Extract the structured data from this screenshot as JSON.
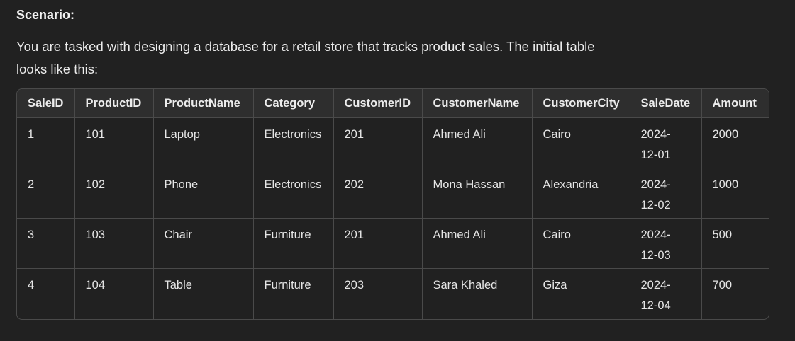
{
  "heading": "Scenario:",
  "intro_line1": "You are tasked with designing a database for a retail store that tracks product sales. The initial table",
  "intro_line2": "looks like this:",
  "table": {
    "columns": [
      "SaleID",
      "ProductID",
      "ProductName",
      "Category",
      "CustomerID",
      "CustomerName",
      "CustomerCity",
      "SaleDate",
      "Amount"
    ],
    "rows": [
      {
        "sale_id": "1",
        "product_id": "101",
        "product_name": "Laptop",
        "category": "Electronics",
        "customer_id": "201",
        "customer_name": "Ahmed Ali",
        "customer_city": "Cairo",
        "sale_date_1": "2024-",
        "sale_date_2": "12-01",
        "amount": "2000"
      },
      {
        "sale_id": "2",
        "product_id": "102",
        "product_name": "Phone",
        "category": "Electronics",
        "customer_id": "202",
        "customer_name": "Mona Hassan",
        "customer_city": "Alexandria",
        "sale_date_1": "2024-",
        "sale_date_2": "12-02",
        "amount": "1000"
      },
      {
        "sale_id": "3",
        "product_id": "103",
        "product_name": "Chair",
        "category": "Furniture",
        "customer_id": "201",
        "customer_name": "Ahmed Ali",
        "customer_city": "Cairo",
        "sale_date_1": "2024-",
        "sale_date_2": "12-03",
        "amount": "500"
      },
      {
        "sale_id": "4",
        "product_id": "104",
        "product_name": "Table",
        "category": "Furniture",
        "customer_id": "203",
        "customer_name": "Sara Khaled",
        "customer_city": "Giza",
        "sale_date_1": "2024-",
        "sale_date_2": "12-04",
        "amount": "700"
      }
    ]
  }
}
